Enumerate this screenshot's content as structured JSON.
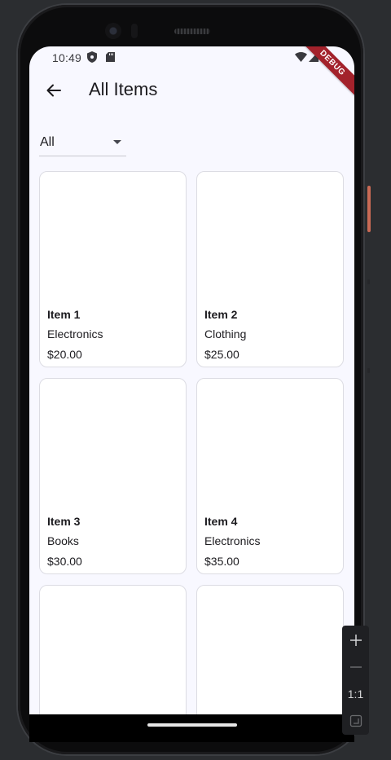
{
  "status_bar": {
    "time": "10:49"
  },
  "debug_banner": {
    "label": "DEBUG"
  },
  "app_bar": {
    "title": "All Items"
  },
  "filter": {
    "selected": "All"
  },
  "items": [
    {
      "name": "Item 1",
      "category": "Electronics",
      "price": "$20.00"
    },
    {
      "name": "Item 2",
      "category": "Clothing",
      "price": "$25.00"
    },
    {
      "name": "Item 3",
      "category": "Books",
      "price": "$30.00"
    },
    {
      "name": "Item 4",
      "category": "Electronics",
      "price": "$35.00"
    },
    {
      "name": "",
      "category": "",
      "price": ""
    },
    {
      "name": "",
      "category": "",
      "price": ""
    }
  ],
  "zoom_controls": {
    "reset_label": "1:1"
  },
  "colors": {
    "screen_background": "#f8f8ff",
    "debug_banner": "#a3222b",
    "device_frame": "#0c0c0d",
    "power_button_accent": "#c96a55"
  }
}
